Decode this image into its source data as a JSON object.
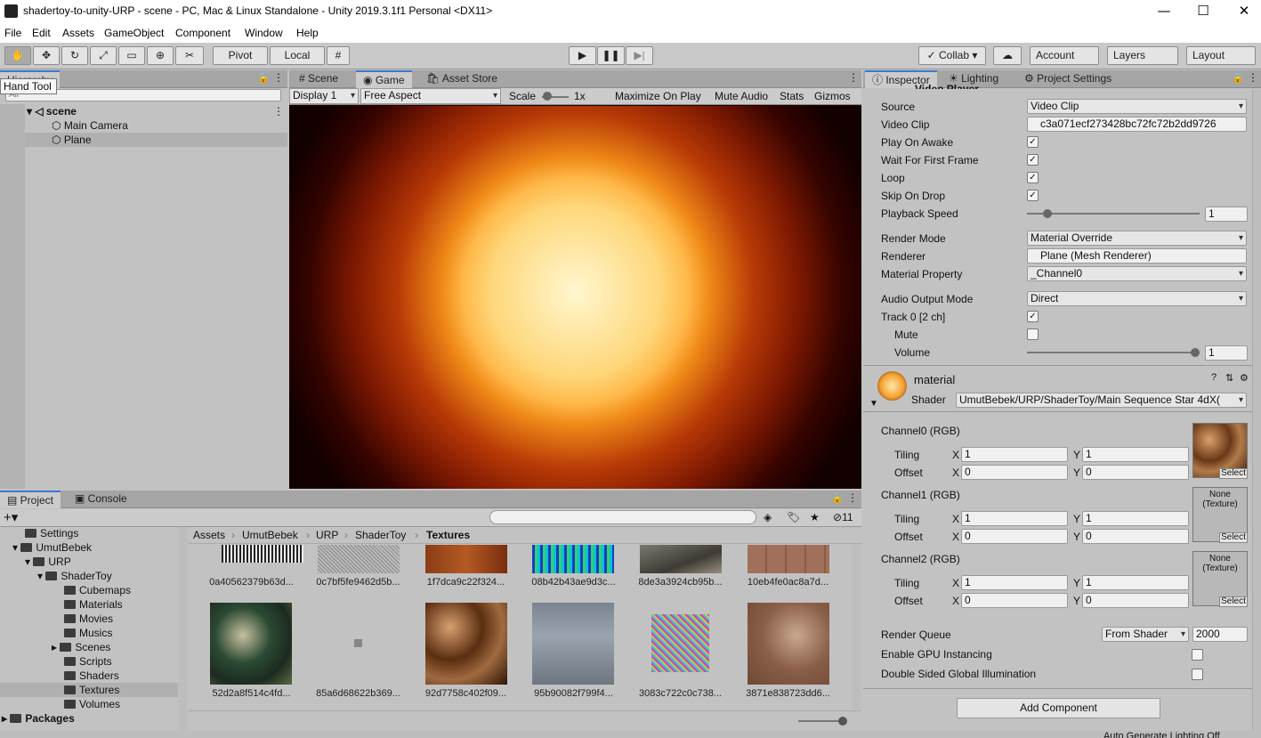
{
  "title_bar": {
    "title": "shadertoy-to-unity-URP - scene - PC, Mac & Linux Standalone - Unity 2019.3.1f1 Personal <DX11>",
    "minimize": "—",
    "maximize": "☐",
    "close": "✕"
  },
  "menu": [
    "File",
    "Edit",
    "Assets",
    "GameObject",
    "Component",
    "Window",
    "Help"
  ],
  "toolbar": {
    "pivot": "Pivot",
    "local": "Local",
    "collab": "Collab",
    "account": "Account",
    "layers": "Layers",
    "layout": "Layout",
    "tooltip": "Hand Tool"
  },
  "hierarchy": {
    "tab": "Hierarchy",
    "search_placeholder": "All",
    "scene": "scene",
    "items": [
      "Main Camera",
      "Plane"
    ]
  },
  "game_view": {
    "tabs": [
      "Scene",
      "Game",
      "Asset Store"
    ],
    "display": "Display 1",
    "aspect": "Free Aspect",
    "scale_label": "Scale",
    "scale_value": "1x",
    "maximize_on_play": "Maximize On Play",
    "mute_audio": "Mute Audio",
    "stats": "Stats",
    "gizmos": "Gizmos"
  },
  "inspector": {
    "tabs": [
      "Inspector",
      "Lighting",
      "Project Settings"
    ],
    "component": "Video Player",
    "fields": [
      {
        "label": "Source",
        "value": "Video Clip"
      },
      {
        "label": "Video Clip",
        "value": "c3a071ecf273428bc72fc72b2dd9726"
      },
      {
        "label": "Play On Awake",
        "value": "✓"
      },
      {
        "label": "Wait For First Frame",
        "value": "✓"
      },
      {
        "label": "Loop",
        "value": "✓"
      },
      {
        "label": "Skip On Drop",
        "value": "✓"
      },
      {
        "label": "Playback Speed",
        "value": "1"
      },
      {
        "label": "Render Mode",
        "value": "Material Override"
      },
      {
        "label": "Renderer",
        "value": "Plane (Mesh Renderer)"
      },
      {
        "label": "Material Property",
        "value": "_Channel0"
      },
      {
        "label": "Audio Output Mode",
        "value": "Direct"
      },
      {
        "label": "Track 0 [2 ch]",
        "value": "✓"
      },
      {
        "label": "Mute",
        "value": ""
      },
      {
        "label": "Volume",
        "value": "1"
      }
    ],
    "material": {
      "name": "material",
      "shader_label": "Shader",
      "shader": "UmutBebek/URP/ShaderToy/Main Sequence Star 4dX(",
      "channels": [
        {
          "title": "Channel0 (RGB)",
          "tiling_x": "1",
          "tiling_y": "1",
          "offset_x": "0",
          "offset_y": "0",
          "tex": ""
        },
        {
          "title": "Channel1 (RGB)",
          "tiling_x": "1",
          "tiling_y": "1",
          "offset_x": "0",
          "offset_y": "0",
          "tex": "None\n(Texture)"
        },
        {
          "title": "Channel2 (RGB)",
          "tiling_x": "1",
          "tiling_y": "1",
          "offset_x": "0",
          "offset_y": "0",
          "tex": "None\n(Texture)"
        }
      ],
      "tiling": "Tiling",
      "offset": "Offset",
      "x": "X",
      "y": "Y",
      "select": "Select",
      "render_queue_label": "Render Queue",
      "render_queue_mode": "From Shader",
      "render_queue_value": "2000",
      "gpu_instancing": "Enable GPU Instancing",
      "double_sided_gi": "Double Sided Global Illumination"
    },
    "add_component": "Add Component"
  },
  "project": {
    "tabs": [
      "Project",
      "Console"
    ],
    "hidden_count": "11",
    "breadcrumb": [
      "Assets",
      "UmutBebek",
      "URP",
      "ShaderToy",
      "Textures"
    ],
    "tree": [
      {
        "label": "Settings",
        "indent": 1
      },
      {
        "label": "UmutBebek",
        "indent": 1
      },
      {
        "label": "URP",
        "indent": 2
      },
      {
        "label": "ShaderToy",
        "indent": 3
      },
      {
        "label": "Cubemaps",
        "indent": 4
      },
      {
        "label": "Materials",
        "indent": 4
      },
      {
        "label": "Movies",
        "indent": 4
      },
      {
        "label": "Musics",
        "indent": 4
      },
      {
        "label": "Scenes",
        "indent": 4
      },
      {
        "label": "Scripts",
        "indent": 4
      },
      {
        "label": "Shaders",
        "indent": 4
      },
      {
        "label": "Textures",
        "indent": 4
      },
      {
        "label": "Volumes",
        "indent": 4
      }
    ],
    "packages": "Packages",
    "assets_row1": [
      "0a40562379b63d...",
      "0c7bf5fe9462d5b...",
      "1f7dca9c22f324...",
      "08b42b43ae9d3c...",
      "8de3a3924cb95b...",
      "10eb4fe0ac8a7d..."
    ],
    "assets_row2": [
      "52d2a8f514c4fd...",
      "85a6d68622b369...",
      "92d7758c402f09...",
      "95b90082f799f4...",
      "3083c722c0c738...",
      "3871e838723dd6..."
    ]
  },
  "status_bar": "Auto Generate Lighting Off"
}
